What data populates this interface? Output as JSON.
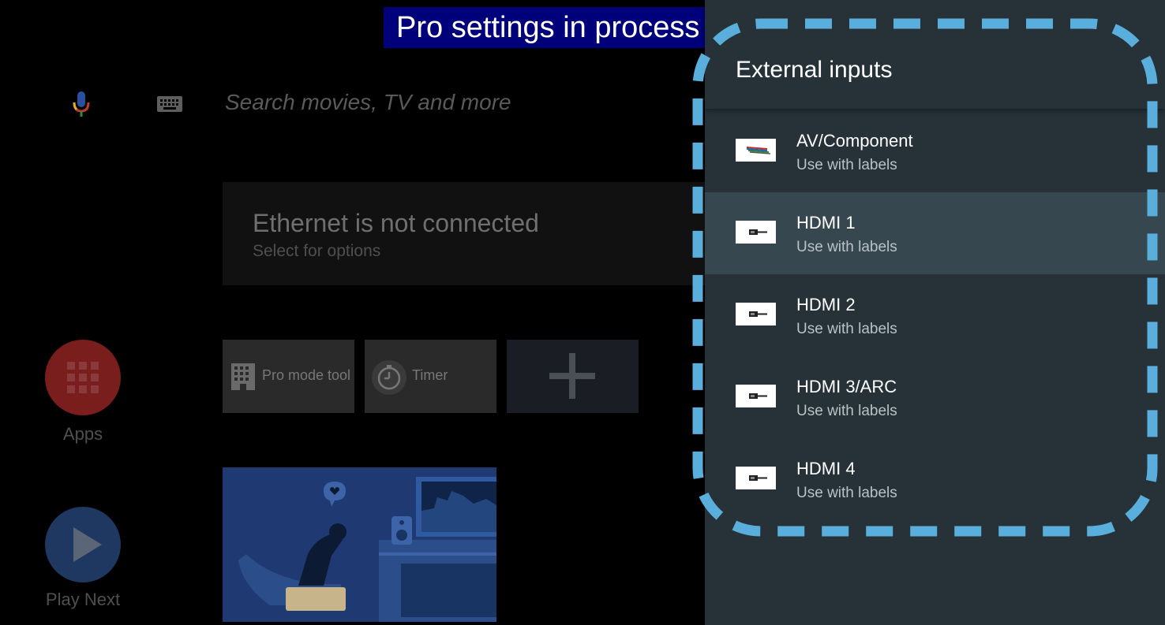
{
  "overlay_banner": "Pro settings in process",
  "search": {
    "placeholder": "Search movies, TV and more",
    "mic_icon": "mic-icon",
    "keyboard_icon": "keyboard-icon"
  },
  "network_card": {
    "title": "Ethernet is not connected",
    "subtitle": "Select for options"
  },
  "sidebar": {
    "apps_label": "Apps",
    "play_next_label": "Play Next"
  },
  "tiles": [
    {
      "label": "Pro mode tool",
      "icon": "pro-mode-icon"
    },
    {
      "label": "Timer",
      "icon": "timer-icon"
    },
    {
      "label": "",
      "icon": "plus-icon"
    }
  ],
  "panel": {
    "title": "External inputs",
    "items": [
      {
        "name": "AV/Component",
        "subtitle": "Use with labels",
        "icon": "av-cable-icon",
        "selected": false
      },
      {
        "name": "HDMI 1",
        "subtitle": "Use with labels",
        "icon": "hdmi-icon",
        "selected": true
      },
      {
        "name": "HDMI 2",
        "subtitle": "Use with labels",
        "icon": "hdmi-icon",
        "selected": false
      },
      {
        "name": "HDMI 3/ARC",
        "subtitle": "Use with labels",
        "icon": "hdmi-icon",
        "selected": false
      },
      {
        "name": "HDMI 4",
        "subtitle": "Use with labels",
        "icon": "hdmi-icon",
        "selected": false
      }
    ]
  },
  "colors": {
    "panel_bg": "#263238",
    "selected_row": "#37474f",
    "dash_outline": "#5aaedc",
    "banner_bg": "#00007a"
  }
}
